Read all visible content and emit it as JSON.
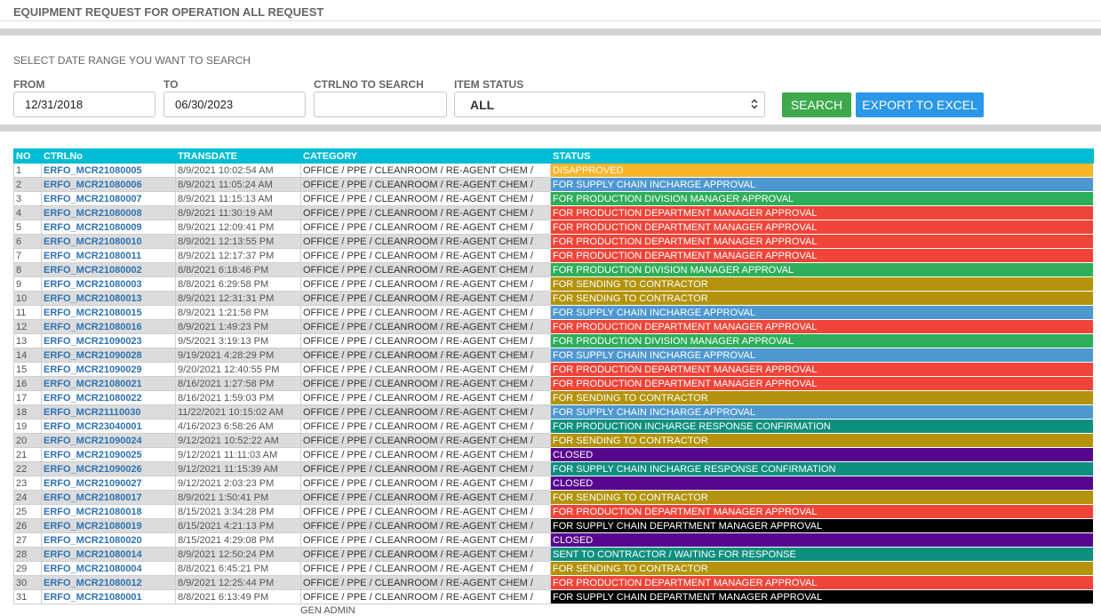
{
  "page": {
    "title": "EQUIPMENT REQUEST FOR OPERATION ALL REQUEST"
  },
  "filters": {
    "range_label": "SELECT DATE RANGE YOU WANT TO SEARCH",
    "from_label": "FROM",
    "from_value": "12/31/2018",
    "to_label": "TO",
    "to_value": "06/30/2023",
    "ctrlno_label": "CTRLNO TO SEARCH",
    "ctrlno_value": "",
    "status_label": "ITEM STATUS",
    "status_value": "ALL",
    "search_button": "SEARCH",
    "export_button": "EXPORT TO EXCEL"
  },
  "table": {
    "headers": [
      "NO",
      "CTRLNo",
      "TRANSDATE",
      "CATEGORY",
      "STATUS"
    ],
    "category_text": "OFFICE / PPE / CLEANROOM / RE-AGENT CHEM /",
    "category_overflow": "GEN ADMIN",
    "status_colors": {
      "disapproved": "#f7b529",
      "supply": "#4e98d0",
      "div": "#2eae5a",
      "dept": "#f04438",
      "contractor": "#b3930b",
      "teal": "#0f8f7d",
      "closed": "#56068f",
      "black": "#000000"
    },
    "rows": [
      {
        "no": "1",
        "ctrl": "ERFO_MCR21080005",
        "date": "8/9/2021 10:02:54 AM",
        "status": "DISAPPROVED",
        "color": "disapproved"
      },
      {
        "no": "2",
        "ctrl": "ERFO_MCR21080006",
        "date": "8/9/2021 11:05:24 AM",
        "status": "FOR SUPPLY CHAIN INCHARGE APPROVAL",
        "color": "supply"
      },
      {
        "no": "3",
        "ctrl": "ERFO_MCR21080007",
        "date": "8/9/2021 11:15:13 AM",
        "status": "FOR PRODUCTION DIVISION MANAGER APPROVAL",
        "color": "div"
      },
      {
        "no": "4",
        "ctrl": "ERFO_MCR21080008",
        "date": "8/9/2021 11:30:19 AM",
        "status": "FOR PRODUCTION DEPARTMENT MANAGER APPROVAL",
        "color": "dept"
      },
      {
        "no": "5",
        "ctrl": "ERFO_MCR21080009",
        "date": "8/9/2021 12:09:41 PM",
        "status": "FOR PRODUCTION DEPARTMENT MANAGER APPROVAL",
        "color": "dept"
      },
      {
        "no": "6",
        "ctrl": "ERFO_MCR21080010",
        "date": "8/9/2021 12:13:55 PM",
        "status": "FOR PRODUCTION DEPARTMENT MANAGER APPROVAL",
        "color": "dept"
      },
      {
        "no": "7",
        "ctrl": "ERFO_MCR21080011",
        "date": "8/9/2021 12:17:37 PM",
        "status": "FOR PRODUCTION DEPARTMENT MANAGER APPROVAL",
        "color": "dept"
      },
      {
        "no": "8",
        "ctrl": "ERFO_MCR21080002",
        "date": "8/8/2021 6:18:46 PM",
        "status": "FOR PRODUCTION DIVISION MANAGER APPROVAL",
        "color": "div"
      },
      {
        "no": "9",
        "ctrl": "ERFO_MCR21080003",
        "date": "8/8/2021 6:29:58 PM",
        "status": "FOR SENDING TO CONTRACTOR",
        "color": "contractor"
      },
      {
        "no": "10",
        "ctrl": "ERFO_MCR21080013",
        "date": "8/9/2021 12:31:31 PM",
        "status": "FOR SENDING TO CONTRACTOR",
        "color": "contractor"
      },
      {
        "no": "11",
        "ctrl": "ERFO_MCR21080015",
        "date": "8/9/2021 1:21:58 PM",
        "status": "FOR SUPPLY CHAIN INCHARGE APPROVAL",
        "color": "supply"
      },
      {
        "no": "12",
        "ctrl": "ERFO_MCR21080016",
        "date": "8/9/2021 1:49:23 PM",
        "status": "FOR PRODUCTION DEPARTMENT MANAGER APPROVAL",
        "color": "dept"
      },
      {
        "no": "13",
        "ctrl": "ERFO_MCR21090023",
        "date": "9/5/2021 3:19:13 PM",
        "status": "FOR PRODUCTION DIVISION MANAGER APPROVAL",
        "color": "div"
      },
      {
        "no": "14",
        "ctrl": "ERFO_MCR21090028",
        "date": "9/19/2021 4:28:29 PM",
        "status": "FOR SUPPLY CHAIN INCHARGE APPROVAL",
        "color": "supply"
      },
      {
        "no": "15",
        "ctrl": "ERFO_MCR21090029",
        "date": "9/20/2021 12:40:55 PM",
        "status": "FOR PRODUCTION DEPARTMENT MANAGER APPROVAL",
        "color": "dept"
      },
      {
        "no": "16",
        "ctrl": "ERFO_MCR21080021",
        "date": "8/16/2021 1:27:58 PM",
        "status": "FOR PRODUCTION DEPARTMENT MANAGER APPROVAL",
        "color": "dept"
      },
      {
        "no": "17",
        "ctrl": "ERFO_MCR21080022",
        "date": "8/16/2021 1:59:03 PM",
        "status": "FOR SENDING TO CONTRACTOR",
        "color": "contractor"
      },
      {
        "no": "18",
        "ctrl": "ERFO_MCR21110030",
        "date": "11/22/2021 10:15:02 AM",
        "status": "FOR SUPPLY CHAIN INCHARGE APPROVAL",
        "color": "supply"
      },
      {
        "no": "19",
        "ctrl": "ERFO_MCR23040001",
        "date": "4/16/2023 6:58:26 AM",
        "status": "FOR PRODUCTION INCHARGE RESPONSE CONFIRMATION",
        "color": "teal"
      },
      {
        "no": "20",
        "ctrl": "ERFO_MCR21090024",
        "date": "9/12/2021 10:52:22 AM",
        "status": "FOR SENDING TO CONTRACTOR",
        "color": "contractor"
      },
      {
        "no": "21",
        "ctrl": "ERFO_MCR21090025",
        "date": "9/12/2021 11:11:03 AM",
        "status": "CLOSED",
        "color": "closed"
      },
      {
        "no": "22",
        "ctrl": "ERFO_MCR21090026",
        "date": "9/12/2021 11:15:39 AM",
        "status": "FOR SUPPLY CHAIN INCHARGE RESPONSE CONFIRMATION",
        "color": "teal"
      },
      {
        "no": "23",
        "ctrl": "ERFO_MCR21090027",
        "date": "9/12/2021 2:03:23 PM",
        "status": "CLOSED",
        "color": "closed"
      },
      {
        "no": "24",
        "ctrl": "ERFO_MCR21080017",
        "date": "8/9/2021 1:50:41 PM",
        "status": "FOR SENDING TO CONTRACTOR",
        "color": "contractor"
      },
      {
        "no": "25",
        "ctrl": "ERFO_MCR21080018",
        "date": "8/15/2021 3:34:28 PM",
        "status": "FOR PRODUCTION DEPARTMENT MANAGER APPROVAL",
        "color": "dept"
      },
      {
        "no": "26",
        "ctrl": "ERFO_MCR21080019",
        "date": "8/15/2021 4:21:13 PM",
        "status": "FOR SUPPLY CHAIN DEPARTMENT MANAGER APPROVAL",
        "color": "black"
      },
      {
        "no": "27",
        "ctrl": "ERFO_MCR21080020",
        "date": "8/15/2021 4:29:08 PM",
        "status": "CLOSED",
        "color": "closed"
      },
      {
        "no": "28",
        "ctrl": "ERFO_MCR21080014",
        "date": "8/9/2021 12:50:24 PM",
        "status": "SENT TO CONTRACTOR / WAITING FOR RESPONSE",
        "color": "teal"
      },
      {
        "no": "29",
        "ctrl": "ERFO_MCR21080004",
        "date": "8/8/2021 6:45:21 PM",
        "status": "FOR SENDING TO CONTRACTOR",
        "color": "contractor"
      },
      {
        "no": "30",
        "ctrl": "ERFO_MCR21080012",
        "date": "8/9/2021 12:25:44 PM",
        "status": "FOR PRODUCTION DEPARTMENT MANAGER APPROVAL",
        "color": "dept"
      },
      {
        "no": "31",
        "ctrl": "ERFO_MCR21080001",
        "date": "8/8/2021 6:13:49 PM",
        "status": "FOR SUPPLY CHAIN DEPARTMENT MANAGER APPROVAL",
        "color": "black"
      }
    ]
  }
}
